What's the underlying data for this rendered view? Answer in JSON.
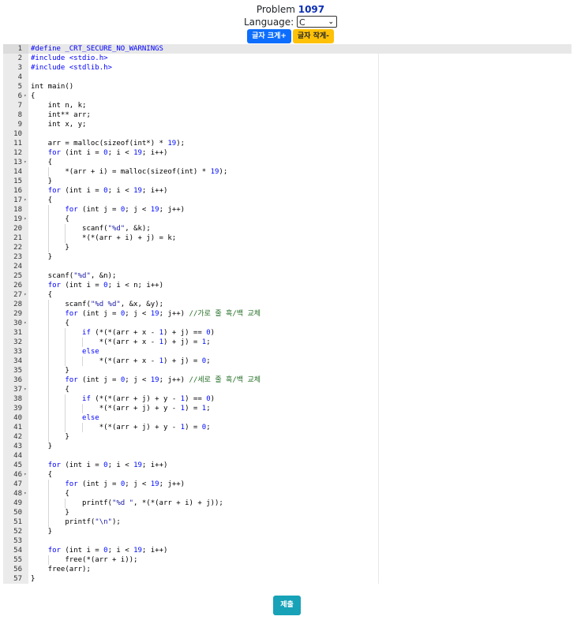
{
  "header": {
    "problem_label": "Problem",
    "problem_number": "1097",
    "language_label": "Language:",
    "language_value": "C",
    "font_up_label": "글자 크게+",
    "font_down_label": "글자 작게-"
  },
  "editor": {
    "active_line": 1,
    "lines": [
      {
        "n": "1",
        "t": "#define _CRT_SECURE_NO_WARNINGS",
        "f": ""
      },
      {
        "n": "2",
        "t": "#include <stdio.h>",
        "f": ""
      },
      {
        "n": "3",
        "t": "#include <stdlib.h>",
        "f": ""
      },
      {
        "n": "4",
        "t": "",
        "f": ""
      },
      {
        "n": "5",
        "t": "int main()",
        "f": ""
      },
      {
        "n": "6",
        "t": "{",
        "f": "▾"
      },
      {
        "n": "7",
        "t": "    int n, k;",
        "f": ""
      },
      {
        "n": "8",
        "t": "    int** arr;",
        "f": ""
      },
      {
        "n": "9",
        "t": "    int x, y;",
        "f": ""
      },
      {
        "n": "10",
        "t": "",
        "f": ""
      },
      {
        "n": "11",
        "t": "    arr = malloc(sizeof(int*) * 19);",
        "f": ""
      },
      {
        "n": "12",
        "t": "    for (int i = 0; i < 19; i++)",
        "f": ""
      },
      {
        "n": "13",
        "t": "    {",
        "f": "▾"
      },
      {
        "n": "14",
        "t": "        *(arr + i) = malloc(sizeof(int) * 19);",
        "f": ""
      },
      {
        "n": "15",
        "t": "    }",
        "f": ""
      },
      {
        "n": "16",
        "t": "    for (int i = 0; i < 19; i++)",
        "f": ""
      },
      {
        "n": "17",
        "t": "    {",
        "f": "▾"
      },
      {
        "n": "18",
        "t": "        for (int j = 0; j < 19; j++)",
        "f": ""
      },
      {
        "n": "19",
        "t": "        {",
        "f": "▾"
      },
      {
        "n": "20",
        "t": "            scanf(\"%d\", &k);",
        "f": ""
      },
      {
        "n": "21",
        "t": "            *(*(arr + i) + j) = k;",
        "f": ""
      },
      {
        "n": "22",
        "t": "        }",
        "f": ""
      },
      {
        "n": "23",
        "t": "    }",
        "f": ""
      },
      {
        "n": "24",
        "t": "",
        "f": ""
      },
      {
        "n": "25",
        "t": "    scanf(\"%d\", &n);",
        "f": ""
      },
      {
        "n": "26",
        "t": "    for (int i = 0; i < n; i++)",
        "f": ""
      },
      {
        "n": "27",
        "t": "    {",
        "f": "▾"
      },
      {
        "n": "28",
        "t": "        scanf(\"%d %d\", &x, &y);",
        "f": ""
      },
      {
        "n": "29",
        "t": "        for (int j = 0; j < 19; j++) //가로 줄 흑/백 교체",
        "f": ""
      },
      {
        "n": "30",
        "t": "        {",
        "f": "▾"
      },
      {
        "n": "31",
        "t": "            if (*(*(arr + x - 1) + j) == 0)",
        "f": ""
      },
      {
        "n": "32",
        "t": "                *(*(arr + x - 1) + j) = 1;",
        "f": ""
      },
      {
        "n": "33",
        "t": "            else",
        "f": ""
      },
      {
        "n": "34",
        "t": "                *(*(arr + x - 1) + j) = 0;",
        "f": ""
      },
      {
        "n": "35",
        "t": "        }",
        "f": ""
      },
      {
        "n": "36",
        "t": "        for (int j = 0; j < 19; j++) //세로 줄 흑/백 교체",
        "f": ""
      },
      {
        "n": "37",
        "t": "        {",
        "f": "▾"
      },
      {
        "n": "38",
        "t": "            if (*(*(arr + j) + y - 1) == 0)",
        "f": ""
      },
      {
        "n": "39",
        "t": "                *(*(arr + j) + y - 1) = 1;",
        "f": ""
      },
      {
        "n": "40",
        "t": "            else",
        "f": ""
      },
      {
        "n": "41",
        "t": "                *(*(arr + j) + y - 1) = 0;",
        "f": ""
      },
      {
        "n": "42",
        "t": "        }",
        "f": ""
      },
      {
        "n": "43",
        "t": "    }",
        "f": ""
      },
      {
        "n": "44",
        "t": "",
        "f": ""
      },
      {
        "n": "45",
        "t": "    for (int i = 0; i < 19; i++)",
        "f": ""
      },
      {
        "n": "46",
        "t": "    {",
        "f": "▾"
      },
      {
        "n": "47",
        "t": "        for (int j = 0; j < 19; j++)",
        "f": ""
      },
      {
        "n": "48",
        "t": "        {",
        "f": "▾"
      },
      {
        "n": "49",
        "t": "            printf(\"%d \", *(*(arr + i) + j));",
        "f": ""
      },
      {
        "n": "50",
        "t": "        }",
        "f": ""
      },
      {
        "n": "51",
        "t": "        printf(\"\\n\");",
        "f": ""
      },
      {
        "n": "52",
        "t": "    }",
        "f": ""
      },
      {
        "n": "53",
        "t": "",
        "f": ""
      },
      {
        "n": "54",
        "t": "    for (int i = 0; i < 19; i++)",
        "f": ""
      },
      {
        "n": "55",
        "t": "        free(*(arr + i));",
        "f": ""
      },
      {
        "n": "56",
        "t": "    free(arr);",
        "f": ""
      },
      {
        "n": "57",
        "t": "}",
        "f": ""
      }
    ]
  },
  "submit_label": "제출"
}
